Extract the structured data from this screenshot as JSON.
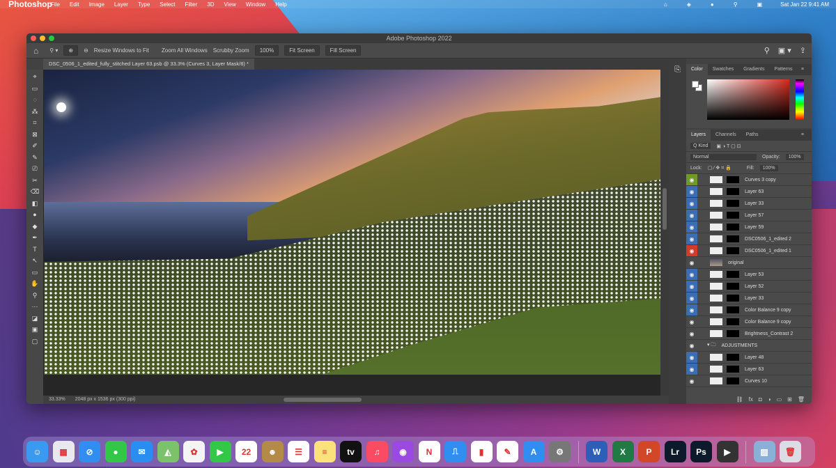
{
  "menubar": {
    "apple": "",
    "app": "Photoshop",
    "items": [
      "File",
      "Edit",
      "Image",
      "Layer",
      "Type",
      "Select",
      "Filter",
      "3D",
      "View",
      "Window",
      "Help"
    ],
    "status_icons": [
      "⌂",
      "◈",
      "●",
      "⚲",
      "▣"
    ],
    "clock": "Sat Jan 22 9:41 AM"
  },
  "window": {
    "title": "Adobe Photoshop 2022"
  },
  "options": {
    "home": "⌂",
    "zoom": "⚲ ▾",
    "zoom_in": "⊕",
    "zoom_out": "⊖",
    "resize": "Resize Windows to Fit",
    "zoom_all": "Zoom All Windows",
    "scrubby": "Scrubby Zoom",
    "percent": "100%",
    "fit": "Fit Screen",
    "fill": "Fill Screen",
    "search": "⚲",
    "workspace": "▣ ▾",
    "share": "⇪"
  },
  "document": {
    "tab": "DSC_0506_1_edited_fully_stitched Layer 63.psb @ 33.3% (Curves 3, Layer Mask/8) *",
    "zoom": "33.33%",
    "doc_info": "2048 px x 1536 px (300 ppi)"
  },
  "tools": [
    "⌖",
    "▭",
    "◌",
    "⁂",
    "⌗",
    "⊠",
    "✐",
    "✎",
    "⎚",
    "✂",
    "⌫",
    "◧",
    "●",
    "◆",
    "✒",
    "T",
    "↖",
    "▭",
    "✋",
    "⚲",
    "⋯",
    "◪",
    "▣",
    "▢"
  ],
  "color_panel": {
    "tabs": [
      "Color",
      "Swatches",
      "Gradients",
      "Patterns"
    ],
    "fg": "#ffffff",
    "hue": "#d42a1e"
  },
  "layers_panel": {
    "tabs": [
      "Layers",
      "Channels",
      "Paths"
    ],
    "filter": "Q Kind",
    "blend": "Normal",
    "opacity_label": "Opacity:",
    "opacity": "100%",
    "lock_label": "Lock:",
    "fill_label": "Fill:",
    "fill": "100%",
    "layers": [
      {
        "name": "Curves 3 copy",
        "eye": "#6f9a2a"
      },
      {
        "name": "Layer 63",
        "eye": "#3b6db2"
      },
      {
        "name": "Layer 33",
        "eye": "#3b6db2"
      },
      {
        "name": "Layer 57",
        "eye": "#3b6db2"
      },
      {
        "name": "Layer 59",
        "eye": "#3b6db2"
      },
      {
        "name": "DSC0506_1_edited 2",
        "eye": "#3b6db2"
      },
      {
        "name": "DSC0506_1_edited 1",
        "eye": "#d33a2c"
      },
      {
        "name": "original",
        "eye": ""
      },
      {
        "name": "Layer 53",
        "eye": "#3b6db2"
      },
      {
        "name": "Layer 52",
        "eye": "#3b6db2"
      },
      {
        "name": "Layer 33",
        "eye": "#3b6db2"
      },
      {
        "name": "Color Balance 9 copy",
        "eye": "#3b6db2"
      },
      {
        "name": "Color Balance 9 copy",
        "eye": ""
      },
      {
        "name": "Brightness_Contrast 2",
        "eye": ""
      },
      {
        "name": "ADJUSTMENTS",
        "eye": ""
      },
      {
        "name": "Layer 48",
        "eye": "#3b6db2"
      },
      {
        "name": "Layer 63",
        "eye": "#3b6db2"
      },
      {
        "name": "Curves 10",
        "eye": ""
      }
    ],
    "bottom_icons": [
      "⛓",
      "fx",
      "◘",
      "◑",
      "▭",
      "⊞",
      "🗑"
    ]
  },
  "dock": [
    {
      "name": "Finder",
      "bg": "#3a9af0",
      "g": "☺"
    },
    {
      "name": "Launchpad",
      "bg": "#e8e8ee",
      "g": "▦"
    },
    {
      "name": "Safari",
      "bg": "#2f8ef0",
      "g": "⊘"
    },
    {
      "name": "Messages",
      "bg": "#33c748",
      "g": "●"
    },
    {
      "name": "Mail",
      "bg": "#2a8ef0",
      "g": "✉"
    },
    {
      "name": "Maps",
      "bg": "#7cc26a",
      "g": "◭"
    },
    {
      "name": "Photos",
      "bg": "#f4f4f4",
      "g": "✿"
    },
    {
      "name": "FaceTime",
      "bg": "#33c748",
      "g": "▶"
    },
    {
      "name": "Calendar",
      "bg": "#ffffff",
      "g": "22"
    },
    {
      "name": "Contacts",
      "bg": "#b48a48",
      "g": "☻"
    },
    {
      "name": "Reminders",
      "bg": "#ffffff",
      "g": "☰"
    },
    {
      "name": "Notes",
      "bg": "#fbe27a",
      "g": "≡"
    },
    {
      "name": "TV",
      "bg": "#111111",
      "g": "tv"
    },
    {
      "name": "Music",
      "bg": "#fb4a64",
      "g": "♫"
    },
    {
      "name": "Podcasts",
      "bg": "#9a4ae0",
      "g": "◉"
    },
    {
      "name": "News",
      "bg": "#ffffff",
      "g": "N"
    },
    {
      "name": "Keynote",
      "bg": "#2f8ef0",
      "g": "⎍"
    },
    {
      "name": "Numbers",
      "bg": "#ffffff",
      "g": "▮"
    },
    {
      "name": "Pages",
      "bg": "#ffffff",
      "g": "✎"
    },
    {
      "name": "App Store",
      "bg": "#2f8ef0",
      "g": "A"
    },
    {
      "name": "System Preferences",
      "bg": "#777777",
      "g": "⚙"
    },
    {
      "sep": true
    },
    {
      "name": "Word",
      "bg": "#2b5fb8",
      "g": "W"
    },
    {
      "name": "Excel",
      "bg": "#1f7a44",
      "g": "X"
    },
    {
      "name": "PowerPoint",
      "bg": "#d24726",
      "g": "P"
    },
    {
      "name": "Lightroom",
      "bg": "#0d1a2c",
      "g": "Lr"
    },
    {
      "name": "Photoshop",
      "bg": "#0d1a2c",
      "g": "Ps"
    },
    {
      "name": "Final Cut Pro",
      "bg": "#333333",
      "g": "▶"
    },
    {
      "sep": true
    },
    {
      "name": "Preview",
      "bg": "#8ab0d8",
      "g": "▨"
    },
    {
      "name": "Trash",
      "bg": "#dcdce4",
      "g": "🗑"
    }
  ]
}
